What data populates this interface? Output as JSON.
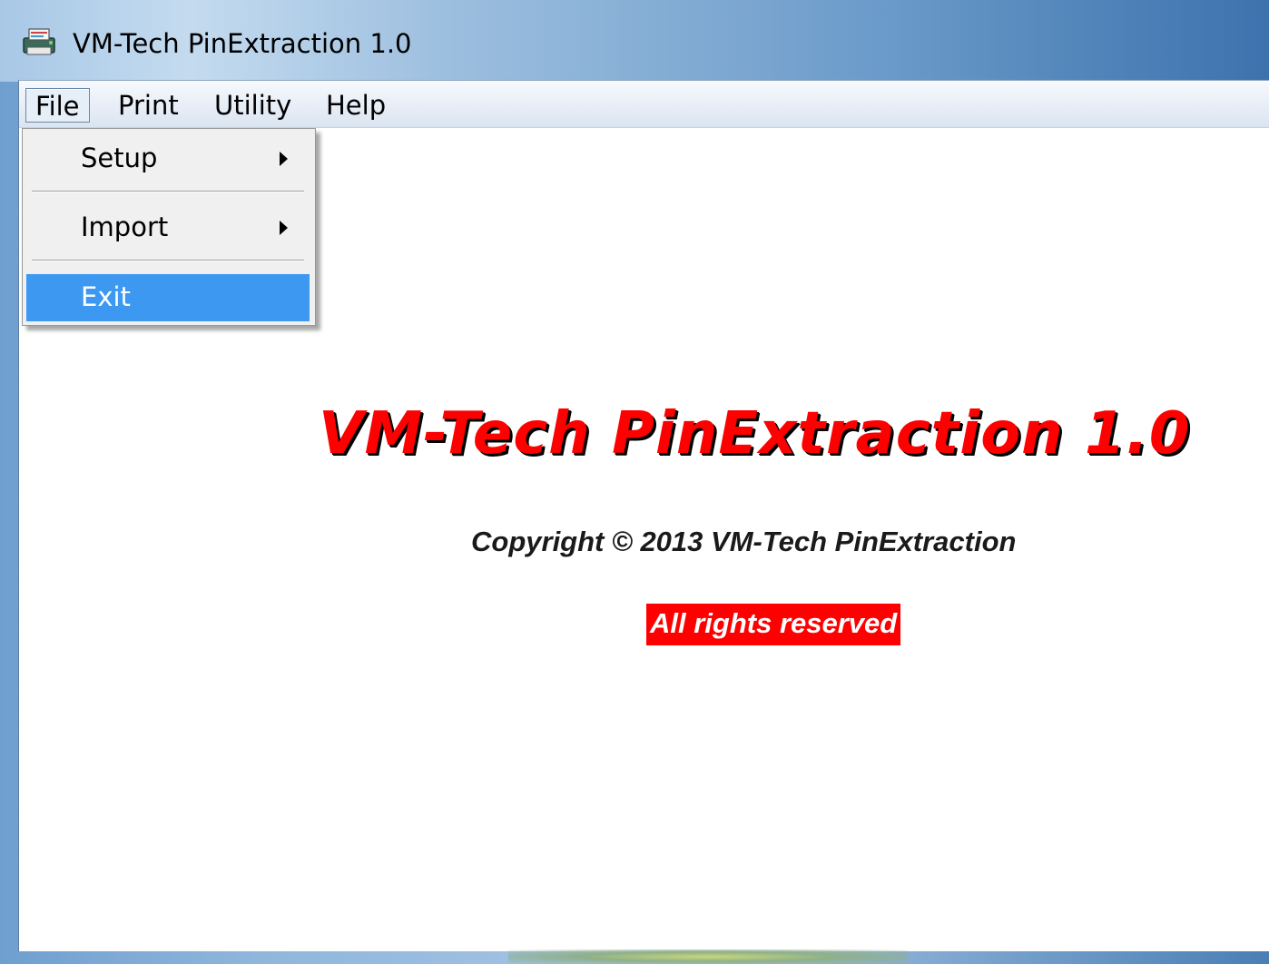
{
  "window": {
    "title": "VM-Tech PinExtraction 1.0",
    "icon": "app-printer-icon"
  },
  "menubar": {
    "items": [
      {
        "label": "File",
        "active": true
      },
      {
        "label": "Print"
      },
      {
        "label": "Utility"
      },
      {
        "label": "Help"
      }
    ]
  },
  "file_menu": {
    "items": [
      {
        "label": "Setup",
        "submenu": true
      },
      {
        "label": "Import",
        "submenu": true
      },
      {
        "label": "Exit",
        "highlighted": true
      }
    ]
  },
  "splash": {
    "title": "VM-Tech PinExtraction 1.0",
    "copyright": "Copyright © 2013 VM-Tech PinExtraction",
    "rights": "All rights reserved"
  },
  "colors": {
    "title_red": "#ff0000",
    "highlight_blue": "#3d98f2",
    "rights_bg": "#ff0000"
  }
}
